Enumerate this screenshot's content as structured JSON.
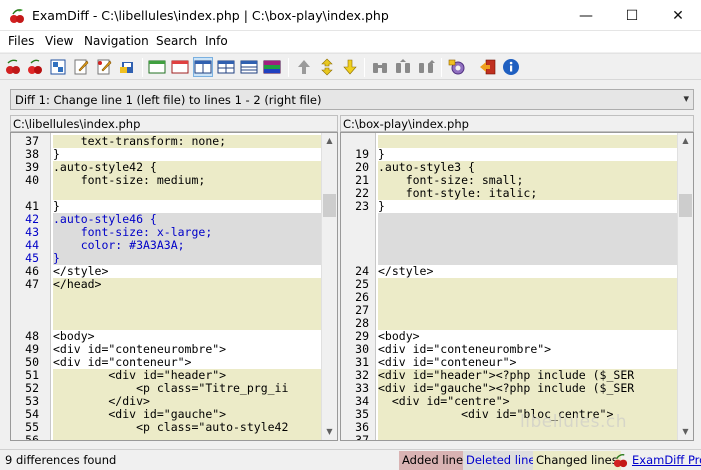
{
  "window": {
    "title": "ExamDiff - C:\\libellules\\index.php  |  C:\\box-play\\index.php",
    "controls": {
      "minimize": "—",
      "maximize": "☐",
      "close": "✕"
    }
  },
  "menu": [
    "Files",
    "View",
    "Navigation",
    "Search",
    "Info"
  ],
  "toolbar": {
    "icons": [
      "open-files-icon",
      "cherry-icon",
      "recompare-icon",
      "edit-left-icon",
      "edit-right-icon",
      "save-icon",
      "show-all-lines-icon",
      "show-diff-lines-icon",
      "side-by-side-icon",
      "layout-grid-icon",
      "layout-rows-icon",
      "layout-colored-icon",
      "first-diff-icon",
      "current-diff-icon",
      "next-diff-icon",
      "binoculars-icon",
      "find-prev-icon",
      "find-next-icon",
      "options-icon",
      "exit-icon",
      "info-icon"
    ]
  },
  "diff_selector": {
    "value": "Diff 1: Change line 1 (left file) to lines 1 - 2 (right file)"
  },
  "left": {
    "path": "C:\\libellules\\index.php",
    "lines": [
      {
        "n": "37",
        "text": "    text-transform: none;",
        "type": "changed"
      },
      {
        "n": "38",
        "text": "}",
        "type": "normal"
      },
      {
        "n": "39",
        "text": ".auto-style42 {",
        "type": "changed"
      },
      {
        "n": "40",
        "text": "    font-size: medium;",
        "type": "changed"
      },
      {
        "n": "",
        "text": "",
        "type": "changed"
      },
      {
        "n": "41",
        "text": "}",
        "type": "normal"
      },
      {
        "n": "42",
        "text": ".auto-style46 {",
        "type": "deleted"
      },
      {
        "n": "43",
        "text": "    font-size: x-large;",
        "type": "deleted"
      },
      {
        "n": "44",
        "text": "    color: #3A3A3A;",
        "type": "deleted"
      },
      {
        "n": "45",
        "text": "}",
        "type": "deleted"
      },
      {
        "n": "46",
        "text": "</style>",
        "type": "normal"
      },
      {
        "n": "47",
        "text": "</head>",
        "type": "changed"
      },
      {
        "n": "",
        "text": "",
        "type": "changed"
      },
      {
        "n": "",
        "text": "",
        "type": "changed"
      },
      {
        "n": "",
        "text": "",
        "type": "changed"
      },
      {
        "n": "48",
        "text": "<body>",
        "type": "normal"
      },
      {
        "n": "49",
        "text": "<div id=\"conteneurombre\">",
        "type": "normal"
      },
      {
        "n": "50",
        "text": "<div id=\"conteneur\">",
        "type": "normal"
      },
      {
        "n": "51",
        "text": "        <div id=\"header\">",
        "type": "changed"
      },
      {
        "n": "52",
        "text": "            <p class=\"Titre_prg_ii",
        "type": "changed"
      },
      {
        "n": "53",
        "text": "        </div>",
        "type": "changed"
      },
      {
        "n": "54",
        "text": "        <div id=\"gauche\">",
        "type": "changed"
      },
      {
        "n": "55",
        "text": "            <p class=\"auto-style42",
        "type": "changed"
      },
      {
        "n": "56",
        "text": "",
        "type": "changed"
      }
    ]
  },
  "right": {
    "path": "C:\\box-play\\index.php",
    "lines": [
      {
        "n": "",
        "text": "",
        "type": "changed"
      },
      {
        "n": "19",
        "text": "}",
        "type": "normal"
      },
      {
        "n": "20",
        "text": ".auto-style3 {",
        "type": "changed"
      },
      {
        "n": "21",
        "text": "    font-size: small;",
        "type": "changed"
      },
      {
        "n": "22",
        "text": "    font-style: italic;",
        "type": "changed"
      },
      {
        "n": "23",
        "text": "}",
        "type": "normal"
      },
      {
        "n": "",
        "text": "",
        "type": "gap"
      },
      {
        "n": "",
        "text": "",
        "type": "gap"
      },
      {
        "n": "",
        "text": "",
        "type": "gap"
      },
      {
        "n": "",
        "text": "",
        "type": "gap"
      },
      {
        "n": "24",
        "text": "</style>",
        "type": "normal"
      },
      {
        "n": "25",
        "text": "",
        "type": "changed"
      },
      {
        "n": "26",
        "text": "",
        "type": "changed"
      },
      {
        "n": "27",
        "text": "",
        "type": "changed"
      },
      {
        "n": "28",
        "text": "",
        "type": "changed"
      },
      {
        "n": "29",
        "text": "<body>",
        "type": "normal"
      },
      {
        "n": "30",
        "text": "<div id=\"conteneurombre\">",
        "type": "normal"
      },
      {
        "n": "31",
        "text": "<div id=\"conteneur\">",
        "type": "normal"
      },
      {
        "n": "32",
        "text": "<div id=\"header\"><?php include ($_SER",
        "type": "changed"
      },
      {
        "n": "33",
        "text": "<div id=\"gauche\"><?php include ($_SER",
        "type": "changed"
      },
      {
        "n": "34",
        "text": "  <div id=\"centre\">",
        "type": "changed"
      },
      {
        "n": "35",
        "text": "            <div id=\"bloc_centre\">",
        "type": "changed"
      },
      {
        "n": "36",
        "text": "",
        "type": "changed"
      },
      {
        "n": "37",
        "text": "",
        "type": "changed"
      }
    ]
  },
  "status": {
    "summary": "9 differences found",
    "legend_added": "Added lines",
    "legend_deleted": "Deleted lines",
    "legend_changed": "Changed lines",
    "pro_link": "ExamDiff Pro"
  },
  "watermark": "libellules.ch",
  "colors": {
    "changed": "#ecebc8",
    "deleted": "#dcdcdc",
    "gap": "#dcdcdc",
    "normal": "#ffffff",
    "deleted_text": "#0000c8",
    "added_bg": "#d9b3b3",
    "deleted_bg": "#dedede",
    "changed_bg": "#ecebc8",
    "link": "#0000cc"
  }
}
